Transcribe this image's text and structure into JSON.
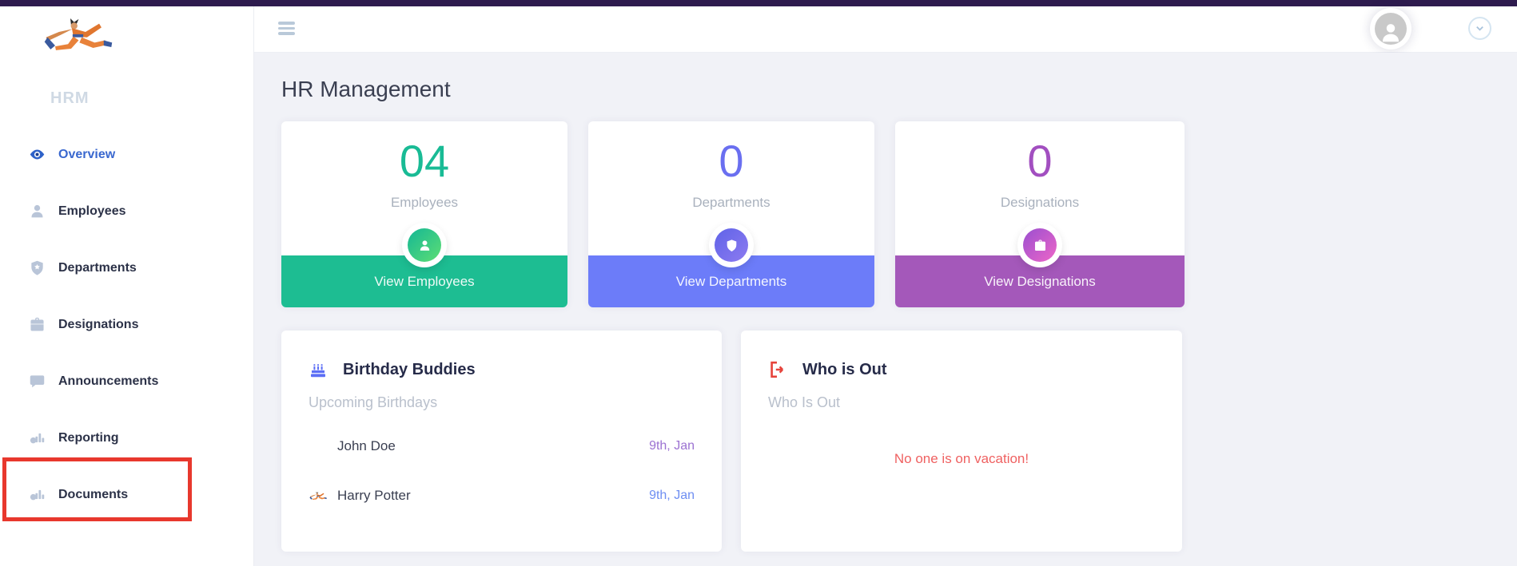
{
  "chrome": {
    "strip_color": "#2e1b4e"
  },
  "sidebar": {
    "brand": "HRM",
    "logo_icon": "martial-artist-logo",
    "items": [
      {
        "label": "Overview",
        "icon": "eye-icon",
        "active": true
      },
      {
        "label": "Employees",
        "icon": "user-icon",
        "active": false
      },
      {
        "label": "Departments",
        "icon": "shield-icon",
        "active": false
      },
      {
        "label": "Designations",
        "icon": "briefcase-icon",
        "active": false
      },
      {
        "label": "Announcements",
        "icon": "chat-icon",
        "active": false
      },
      {
        "label": "Reporting",
        "icon": "chart-icon",
        "active": false
      },
      {
        "label": "Documents",
        "icon": "chart-icon",
        "active": false,
        "annotated": true
      }
    ],
    "annotation_color": "#e8382d"
  },
  "topbar": {
    "hamburger_icon": "menu-icon",
    "avatar_icon": "user-avatar",
    "chevron_icon": "chevron-down-icon"
  },
  "page": {
    "title": "HR Management"
  },
  "stats": [
    {
      "value": "04",
      "label": "Employees",
      "action": "View Employees",
      "icon": "user-icon",
      "number_color": "#19bb95",
      "footer_color": "#1dbd92",
      "icon_gradient": [
        "#14b795",
        "#5ede74"
      ]
    },
    {
      "value": "0",
      "label": "Departments",
      "action": "View Departments",
      "icon": "shield-icon",
      "number_color": "#6a6ff0",
      "footer_color": "#6c7cf9",
      "icon_gradient": [
        "#5f63e8",
        "#8d7bf0"
      ]
    },
    {
      "value": "0",
      "label": "Designations",
      "action": "View Designations",
      "icon": "briefcase-icon",
      "number_color": "#a24fc0",
      "footer_color": "#a458ba",
      "icon_gradient": [
        "#9a4fd0",
        "#ee66c8"
      ]
    }
  ],
  "birthday_panel": {
    "icon": "cake-icon",
    "icon_color": "#5c6ef5",
    "title": "Birthday Buddies",
    "subtitle": "Upcoming Birthdays",
    "rows": [
      {
        "name": "John Doe",
        "date": "9th, Jan",
        "date_color": "#9c72d2",
        "avatar": null
      },
      {
        "name": "Harry Potter",
        "date": "9th, Jan",
        "date_color": "#6e8ef2",
        "avatar": "martial-artist"
      }
    ]
  },
  "whoisout_panel": {
    "icon": "sign-out-icon",
    "icon_color": "#e6443c",
    "title": "Who is Out",
    "subtitle": "Who Is Out",
    "empty_message": "No one is on vacation!",
    "message_color": "#ef6161"
  }
}
